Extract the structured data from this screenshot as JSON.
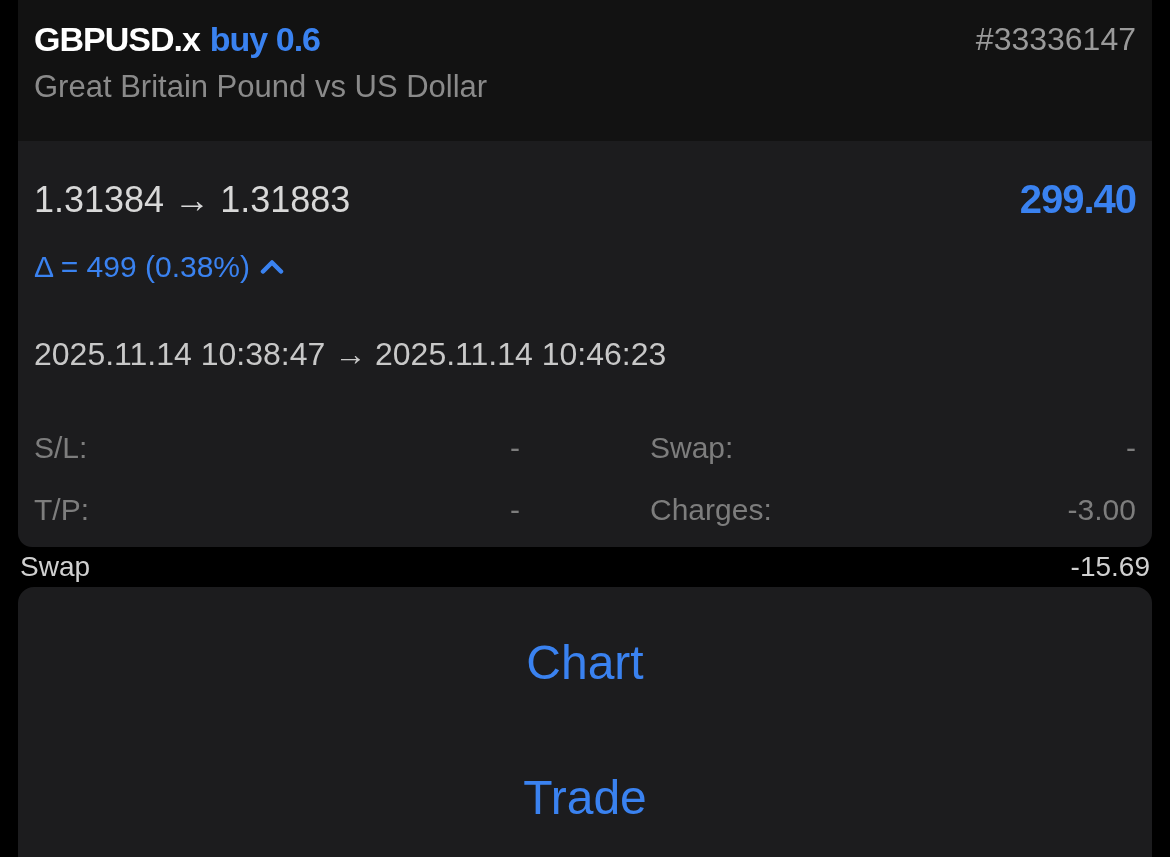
{
  "trade": {
    "symbol": "GBPUSD.x",
    "side": "buy 0.6",
    "ticket": "#33336147",
    "description": "Great Britain Pound vs US Dollar",
    "prices": "1.31384 → 1.31883",
    "profit": "299.40",
    "delta": "Δ = 499 (0.38%)",
    "delta_rising": true,
    "times": "2025.11.14 10:38:47 → 2025.11.14 10:46:23",
    "details": [
      {
        "label": "S/L:",
        "value": "-"
      },
      {
        "label": "Swap:",
        "value": "-"
      },
      {
        "label": "T/P:",
        "value": "-"
      },
      {
        "label": "Charges:",
        "value": "-3.00"
      }
    ]
  },
  "background_row": {
    "label": "Swap",
    "value": "-15.69"
  },
  "actions": [
    "Chart",
    "Trade"
  ]
}
